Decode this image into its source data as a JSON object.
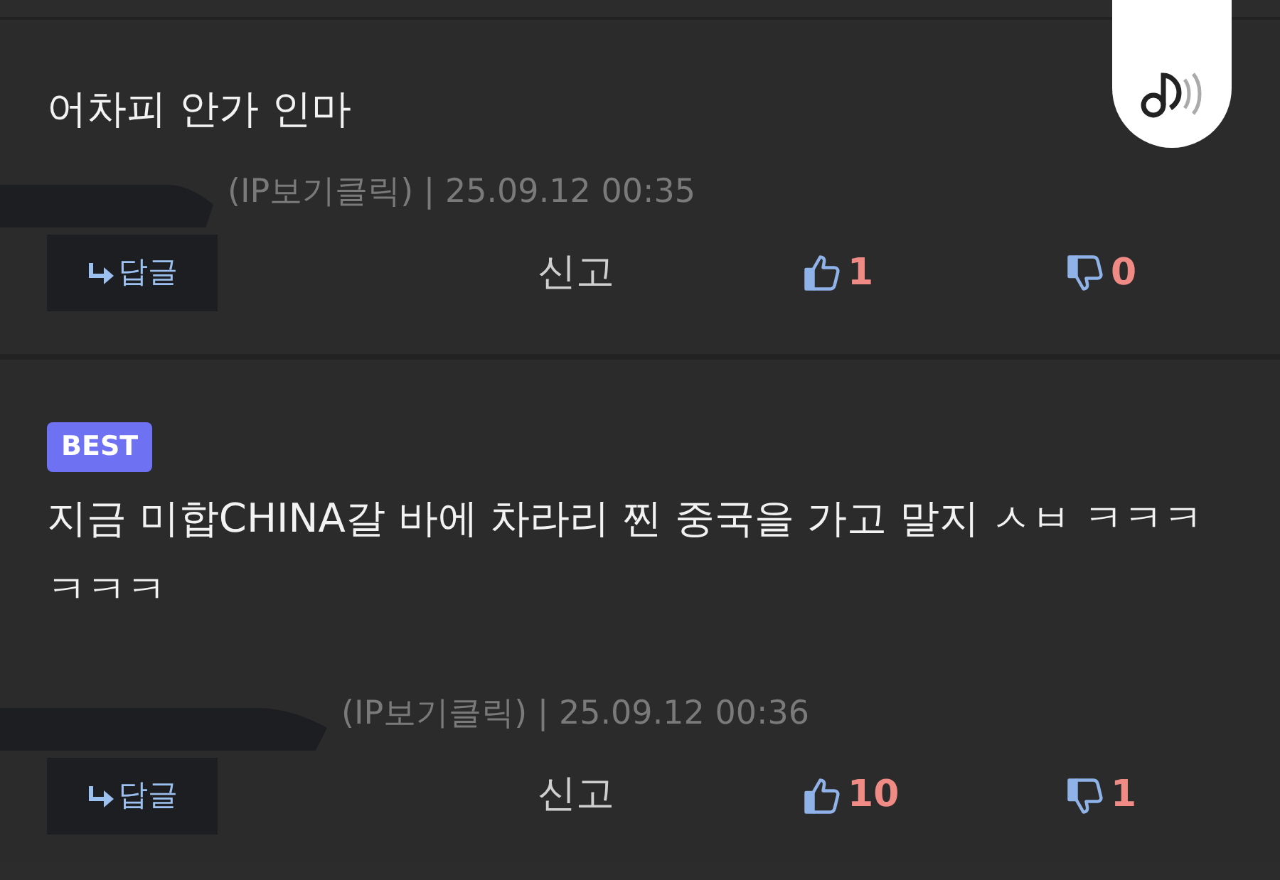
{
  "audio_button": {
    "kind": "music"
  },
  "comments": [
    {
      "best": false,
      "text": "어차피 안가 인마",
      "meta": "(IP보기클릭) | 25.09.12 00:35",
      "reply": "답글",
      "report": "신고",
      "likes": "1",
      "dislikes": "0"
    },
    {
      "best": true,
      "badge": "BEST",
      "text": "지금 미합CHINA갈 바에 차라리 찐 중국을 가고 말지 ㅅㅂ ㅋㅋㅋㅋㅋㅋ",
      "meta": "(IP보기클릭) | 25.09.12 00:36",
      "reply": "답글",
      "report": "신고",
      "likes": "10",
      "dislikes": "1"
    }
  ]
}
